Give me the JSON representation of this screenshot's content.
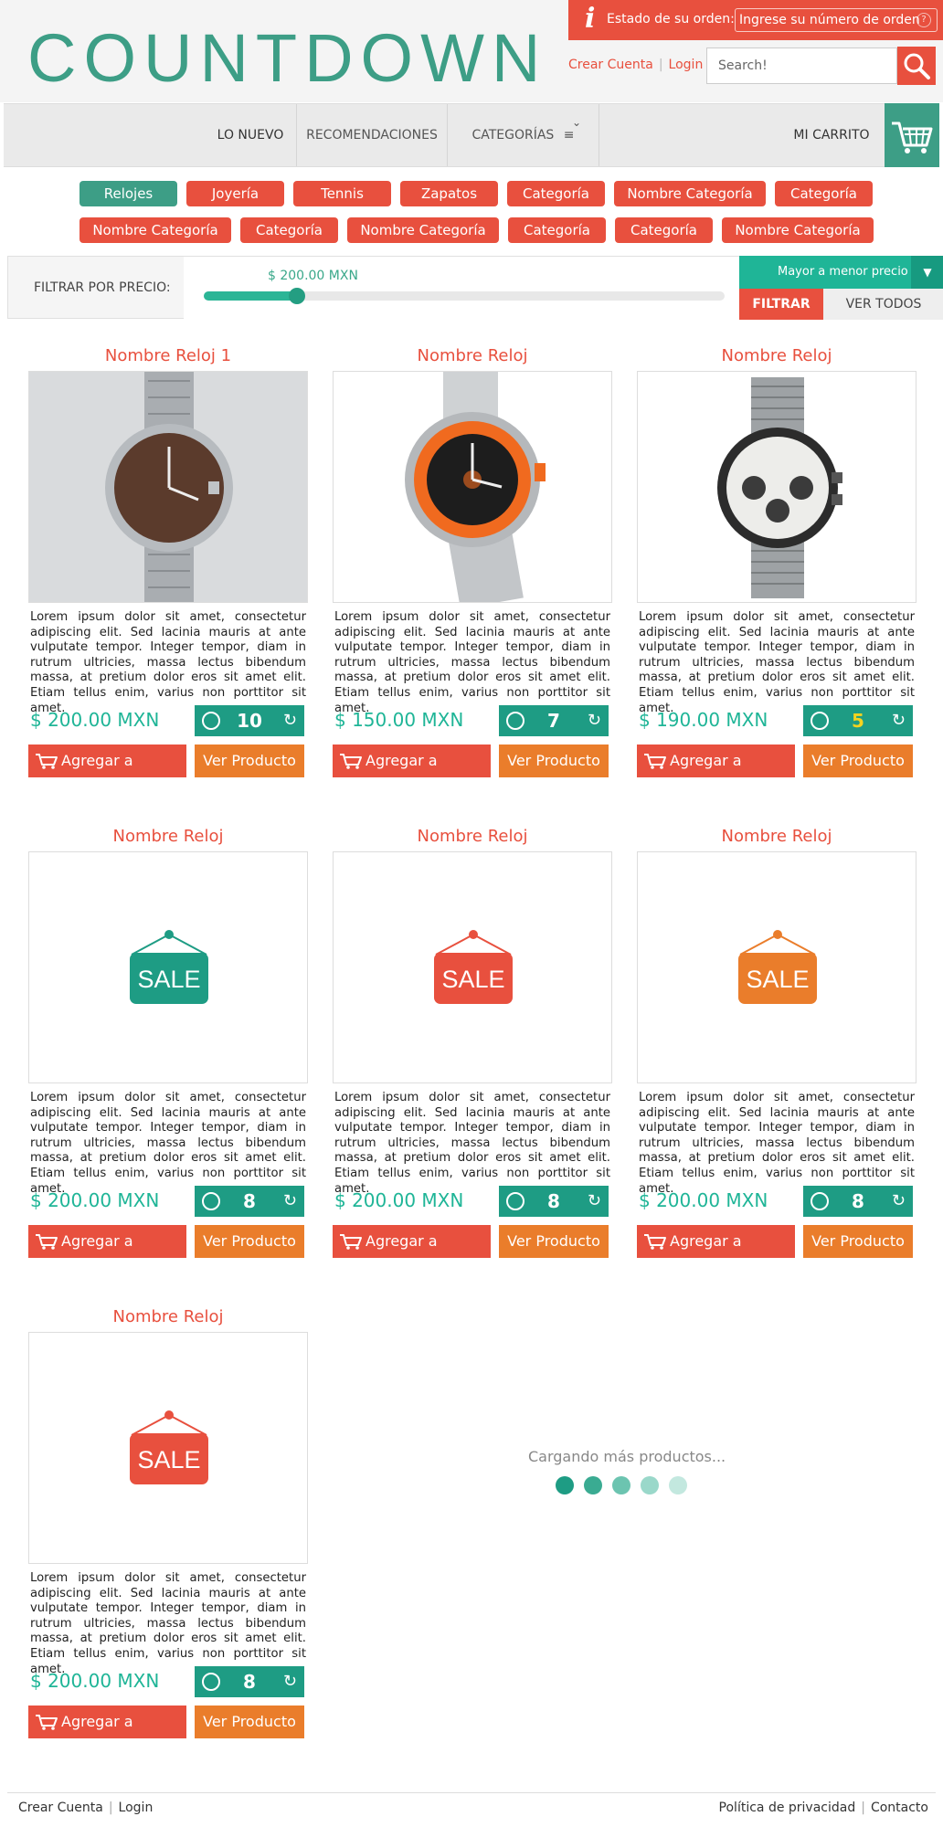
{
  "header": {
    "logo": "COUNTDOWN",
    "order_label": "Estado de su orden:",
    "order_placeholder": "Ingrese su número de orden",
    "order_info_glyph": "i",
    "order_help_glyph": "?",
    "create_account": "Crear Cuenta",
    "login": "Login",
    "search_placeholder": "Search!"
  },
  "nav": {
    "new": "LO NUEVO",
    "recommendations": "RECOMENDACIONES",
    "categories": "CATEGORÍAS",
    "cart": "MI CARRITO"
  },
  "tags": [
    "Relojes",
    "Joyería",
    "Tennis",
    "Zapatos",
    "Categoría",
    "Nombre Categoría",
    "Categoría",
    "Nombre Categoría",
    "Categoría",
    "Nombre Categoría",
    "Categoría",
    "Categoría",
    "Nombre Categoría"
  ],
  "filter": {
    "label": "FILTRAR POR PRECIO:",
    "price_value": "$ 200.00 MXN",
    "price_level": 0.17,
    "sort": "Mayor a menor precio",
    "filter_btn": "FILTRAR",
    "view_all": "VER TODOS"
  },
  "products": [
    {
      "title": "Nombre Reloj 1",
      "image": "watch-brown-dial",
      "price": "$ 200.00 MXN",
      "timer": "10",
      "timer_color": "#ffffff"
    },
    {
      "title": "Nombre Reloj",
      "image": "watch-orange-bezel",
      "price": "$ 150.00 MXN",
      "timer": "7",
      "timer_color": "#ffffff"
    },
    {
      "title": "Nombre Reloj",
      "image": "watch-chronograph-mesh",
      "price": "$ 190.00 MXN",
      "timer": "5",
      "timer_color": "#f5d31f"
    },
    {
      "title": "Nombre Reloj",
      "image": "sale-sign",
      "sale_color": "#1e9c84",
      "price": "$ 200.00 MXN",
      "timer": "8",
      "timer_color": "#ffffff"
    },
    {
      "title": "Nombre Reloj",
      "image": "sale-sign",
      "sale_color": "#e8503e",
      "price": "$ 200.00 MXN",
      "timer": "8",
      "timer_color": "#ffffff"
    },
    {
      "title": "Nombre Reloj",
      "image": "sale-sign",
      "sale_color": "#ea7d2b",
      "price": "$ 200.00 MXN",
      "timer": "8",
      "timer_color": "#ffffff"
    },
    {
      "title": "Nombre Reloj",
      "image": "sale-sign",
      "sale_color": "#e8503e",
      "price": "$ 200.00 MXN",
      "timer": "8",
      "timer_color": "#ffffff"
    }
  ],
  "product_common": {
    "description": "Lorem ipsum dolor sit amet, consectetur adipiscing elit. Sed lacinia mauris at ante vulputate tempor. Integer tempor, diam in rutrum ultricies, massa lectus bibendum massa, at pretium dolor eros sit amet elit. Etiam tellus enim, varius non porttitor sit amet.",
    "sale_text": "SALE",
    "add_to_cart": "Agregar a Carrito",
    "view_product": "Ver Producto"
  },
  "loading": {
    "text": "Cargando más productos...",
    "dot_colors": [
      "#1e9c84",
      "#3aab92",
      "#6cc4b0",
      "#9ad8ca",
      "#c3e8df"
    ]
  },
  "footer": {
    "create_account": "Crear Cuenta",
    "login": "Login",
    "privacy": "Política de privacidad",
    "contact": "Contacto"
  },
  "colors": {
    "brand_green": "#3d9e86",
    "brand_red": "#e8503e",
    "accent_orange": "#ea7d2b",
    "price_green": "#1fb597"
  }
}
